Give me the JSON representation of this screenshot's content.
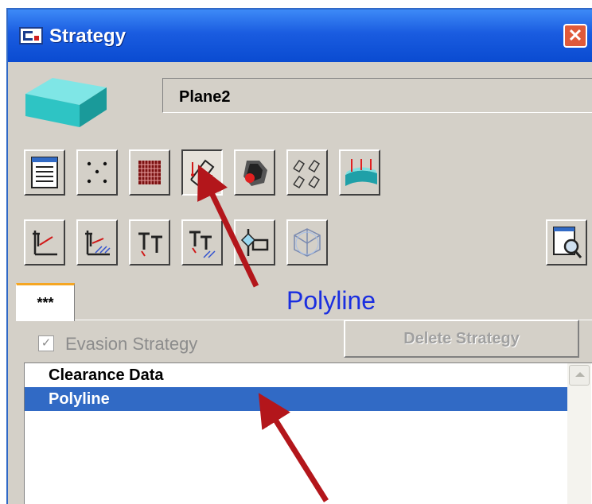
{
  "window": {
    "title": "Strategy",
    "close_symbol": "✕"
  },
  "name_field": {
    "value": "Plane2"
  },
  "toolbar_row1": [
    {
      "icon": "list-document-icon"
    },
    {
      "icon": "points-icon"
    },
    {
      "icon": "grid-icon"
    },
    {
      "icon": "polyline-icon",
      "pressed": true
    },
    {
      "icon": "tool-collision-icon"
    },
    {
      "icon": "multi-polyline-icon"
    },
    {
      "icon": "surface-arrows-icon"
    }
  ],
  "toolbar_row2": [
    {
      "icon": "axis-tool-icon"
    },
    {
      "icon": "axis-tool-hatched-icon"
    },
    {
      "icon": "tool-t-icon"
    },
    {
      "icon": "tool-t-hatched-icon"
    },
    {
      "icon": "tool-holder-icon"
    },
    {
      "icon": "cube-icon"
    },
    {
      "icon": "document-search-icon"
    }
  ],
  "tab": {
    "label": "***"
  },
  "annotation": {
    "text": "Polyline",
    "color": "#1a2ee0"
  },
  "evasion": {
    "label": "Evasion Strategy",
    "checked": true
  },
  "delete_button": {
    "label": "Delete Strategy"
  },
  "list": {
    "items": [
      {
        "label": "Clearance Data",
        "selected": false
      },
      {
        "label": "Polyline",
        "selected": true
      }
    ]
  },
  "colors": {
    "titlebar": "#0a4bd1",
    "selection": "#316ac5",
    "arrow": "#b3161b",
    "part": "#2ec4c4"
  }
}
